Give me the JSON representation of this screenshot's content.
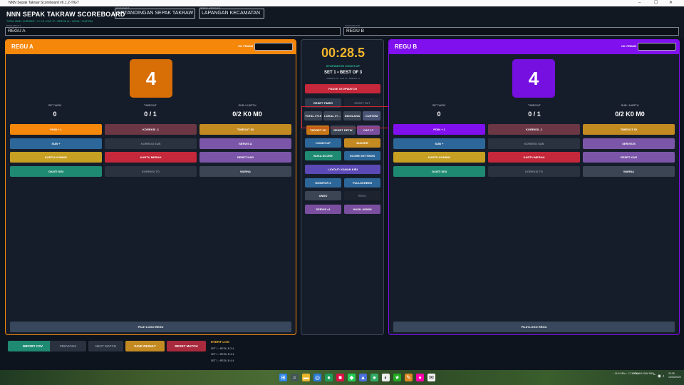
{
  "window": {
    "title": "NNN Sepak Takraw Scoreboard v6.1.2-TIGT"
  },
  "header": {
    "app_title": "NNN SEPAK TAKRAW SCOREBOARD",
    "event_caption": "NAMA EVENT",
    "event_name": "ERTANDINGAN SEPAK TAKRAW",
    "venue_caption": "VENUE / LAPANGAN",
    "venue_name": "LAPANGAN KECAMATAN",
    "status": "TOTAL 2828 • CURRENT • 3 × 15 • CAP 17 • SERVIS x1 • LOKAL / CUSTOM",
    "team_a_caption": "NAMA REGU A",
    "team_a_name": "REGU A",
    "team_b_caption": "NAMA REGU B",
    "team_b_name": "REGU B"
  },
  "team_a": {
    "name": "REGU A",
    "player_no_label": "NO. PEMAIN",
    "score": "4",
    "set_won_label": "SET WON",
    "set_won": "0",
    "timeout_label": "TIMEOUT",
    "timeout": "0 / 1",
    "sub_label": "SUB / KARTU",
    "sub": "0/2  K0 M0",
    "buttons": {
      "poin": "POIN + 1",
      "koreksi": "KOREKSI -1",
      "timeout": "TIMEOUT 60",
      "sub": "SUB +",
      "koreksi_sub": "KOREKSI SUB",
      "servis": "SERVIS A",
      "kartu_kuning": "KARTU KUNING",
      "kartu_merah": "KARTU MERAH",
      "reset_kartu": "RESET KAR",
      "ganti_sisi": "GANTI SISI",
      "koreksi_to": "KOREKSI TO",
      "warna": "WARNA"
    },
    "logo_button": "PILIH LOGO REGU",
    "color": "#f5870b"
  },
  "team_b": {
    "name": "REGU B",
    "player_no_label": "NO. PEMAIN",
    "score": "4",
    "set_won_label": "SET WON",
    "set_won": "0",
    "timeout_label": "TIMEOUT",
    "timeout": "0 / 1",
    "sub_label": "SUB / KARTU",
    "sub": "0/2  K0 M0",
    "buttons": {
      "poin": "POIN + 1",
      "koreksi": "KOREKSI -1",
      "timeout": "TIMEOUT 60",
      "sub": "SUB +",
      "koreksi_sub": "KOREKSI SUB",
      "servis": "SERVIS B",
      "kartu_kuning": "KARTU KUNING",
      "kartu_merah": "KARTU MERAH",
      "reset_kartu": "RESET KAR",
      "ganti_sisi": "GANTI SISI",
      "koreksi_to": "KOREKSI TO",
      "warna": "WARNA"
    },
    "logo_button": "PILIH LOGO REGU",
    "color": "#8010ee"
  },
  "center": {
    "timer": "00:28.5",
    "mode": "STOPWATCH COUNT-UP",
    "set_info": "SET 1 • BEST OF 3",
    "sub_info": "TARGET 15 • CAP 17 • SERVIS x1",
    "pause": "PAUSE STOPWATCH",
    "reset_timer": "RESET TIMER",
    "reset_set": "RESET SET",
    "preset_total": "TOTAL 3+15",
    "preset_lokal": "LOKAL 3+...",
    "preset_indolaga": "INDOLAGA",
    "preset_custom": "CUSTOM",
    "target": "TARGET 15",
    "reset_detik": "RESET DETIK",
    "cap": "CAP 17",
    "count_up": "COUNT-UP",
    "buzzer": "BUZZER",
    "buka_score": "BUKA SCORE",
    "score_settings": "SCORE SETTINGS",
    "layout": "LAYOUT: KANAN  KIRI",
    "monitor": "MONITOR 2",
    "fullscreen": "FULLSCREEN",
    "undo": "UNDO",
    "redo": "REDO",
    "servis": "SERVIS x1",
    "hasil_admin": "HASIL ADMIN"
  },
  "bottom": {
    "import_csv": "IMPORT CSV",
    "previous": "PREVIOUS",
    "next_match": "NEXT MATCH",
    "save_result": "SAVE RESULT",
    "reset_match": "RESET MATCH",
    "event_log_title": "EVENT LOG",
    "event_log": [
      "SET 1 • REGU B 2-4",
      "SET 1 • REGU B 3-4",
      "SET 1 • REGU B 4-4"
    ]
  },
  "taskbar": {
    "net": "↑ 16.0 KB/s\n↓ 2.74 KB/s",
    "cpu": "CPU 6%\nRAM 58%",
    "time": "23:38",
    "date": "13/03/2026"
  }
}
